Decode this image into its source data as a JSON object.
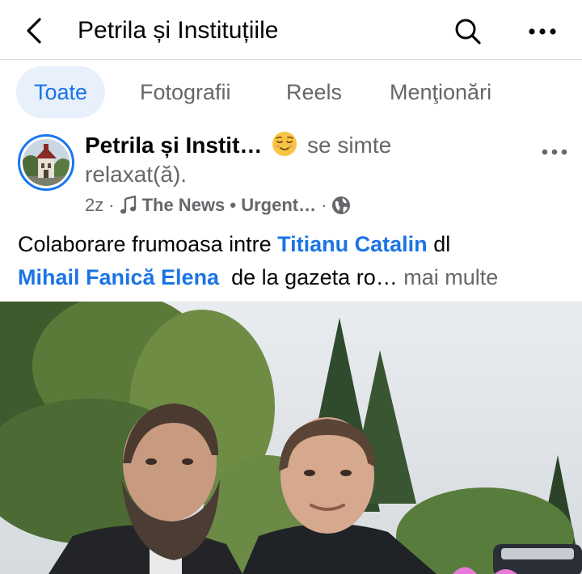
{
  "header": {
    "title": "Petrila și Instituțiile",
    "back_icon": "chevron-left-icon",
    "search_icon": "search-icon",
    "more_icon": "more-horizontal-icon"
  },
  "tabs": [
    {
      "label": "Toate",
      "active": true
    },
    {
      "label": "Fotografii",
      "active": false
    },
    {
      "label": "Reels",
      "active": false
    },
    {
      "label": "Menţionări",
      "active": false
    }
  ],
  "post": {
    "author": "Petrila și Instit…",
    "feeling_emoji": "relieved-face-emoji",
    "feeling_prefix": "se simte",
    "feeling": "relaxat(ă).",
    "time": "2z",
    "music_icon": "music-note-icon",
    "song": "The News • Urgent…",
    "separator": "·",
    "audience_icon": "globe-icon",
    "text_start": "Colaborare frumoasa intre ",
    "mention_1": "Titianu Catalin",
    "text_mid": " dl",
    "mention_2": "Mihail Fanică Elena",
    "text_end": "  de la gazeta ro…",
    "see_more": "mai multe"
  },
  "colors": {
    "accent": "#1b74e4",
    "tab_active_bg": "#e7f0fb",
    "muted": "#65676b",
    "text": "#050505"
  }
}
